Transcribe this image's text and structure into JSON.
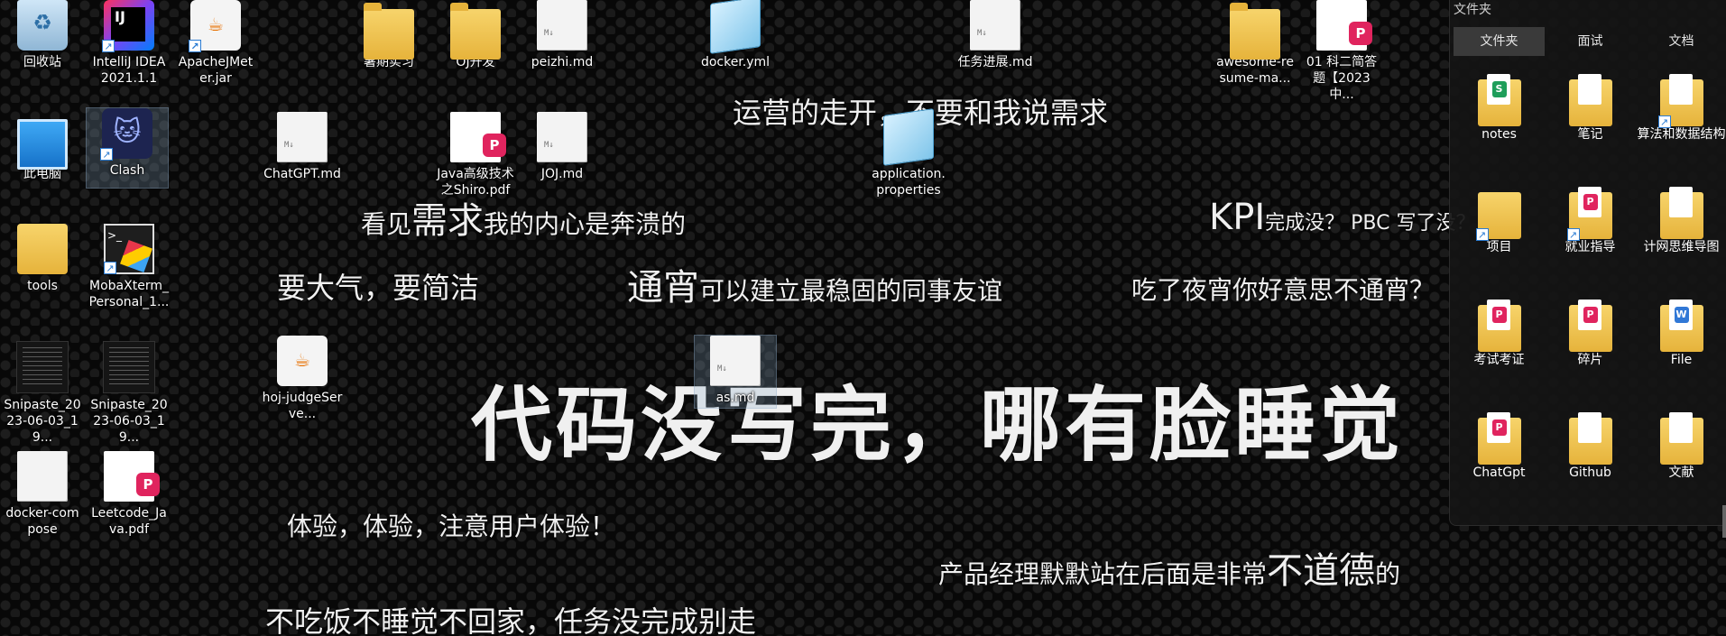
{
  "wallpaper": {
    "headline": "代码没写完，哪有脸睡觉",
    "lines": [
      {
        "id": "l1",
        "text": "运营的走开，不要和我说需求"
      },
      {
        "id": "l2_pre",
        "text": "看见"
      },
      {
        "id": "l2_big",
        "text": "需求"
      },
      {
        "id": "l2_post",
        "text": "我的内心是奔溃的"
      },
      {
        "id": "l3",
        "text": "要大气，要简洁"
      },
      {
        "id": "l4_big",
        "text": "通宵"
      },
      {
        "id": "l4_post",
        "text": "可以建立最稳固的同事友谊"
      },
      {
        "id": "l5_big",
        "text": "KPI"
      },
      {
        "id": "l5_post",
        "text": "完成没？ PBC 写了没？"
      },
      {
        "id": "l6",
        "text": "吃了夜宵你好意思不通宵？"
      },
      {
        "id": "l7",
        "text": "体验，体验，注意用户体验！"
      },
      {
        "id": "l8_pre",
        "text": "产品经理默默站在后面是非常"
      },
      {
        "id": "l8_big",
        "text": "不道德"
      },
      {
        "id": "l8_post",
        "text": "的"
      },
      {
        "id": "l9",
        "text": "不吃饭不睡觉不回家，任务没完成别走"
      }
    ]
  },
  "desktop_icons": [
    {
      "label": "回收站",
      "icon": "recycle-bin-icon"
    },
    {
      "label": "IntelliJ IDEA 2021.1.1",
      "icon": "intellij-icon"
    },
    {
      "label": "ApacheJMeter.jar",
      "icon": "java-icon"
    },
    {
      "label": "暑期实习",
      "icon": "folder-icon"
    },
    {
      "label": "OJ开发",
      "icon": "folder-icon"
    },
    {
      "label": "peizhi.md",
      "icon": "markdown-file-icon"
    },
    {
      "label": "docker.yml",
      "icon": "notepad-icon"
    },
    {
      "label": "任务进展.md",
      "icon": "markdown-file-icon"
    },
    {
      "label": "awesome-resume-ma...",
      "icon": "folder-icon"
    },
    {
      "label": "01 科二简答题【2023中...",
      "icon": "pdf-icon"
    },
    {
      "label": "此电脑",
      "icon": "computer-icon"
    },
    {
      "label": "Clash",
      "icon": "clash-icon"
    },
    {
      "label": "ChatGPT.md",
      "icon": "markdown-file-icon"
    },
    {
      "label": "Java高级技术之Shiro.pdf",
      "icon": "pdf-icon"
    },
    {
      "label": "JOJ.md",
      "icon": "markdown-file-icon"
    },
    {
      "label": "application.properties",
      "icon": "notepad-icon"
    },
    {
      "label": "tools",
      "icon": "folder-icon"
    },
    {
      "label": "MobaXterm_Personal_1...",
      "icon": "mobaxterm-icon"
    },
    {
      "label": "Snipaste_2023-06-03_19...",
      "icon": "screenshot-icon"
    },
    {
      "label": "Snipaste_2023-06-03_19...",
      "icon": "screenshot-icon"
    },
    {
      "label": "hoj-judgeServe...",
      "icon": "java-icon"
    },
    {
      "label": "as.md",
      "icon": "markdown-file-icon"
    },
    {
      "label": "docker-compose",
      "icon": "file-icon"
    },
    {
      "label": "Leetcode_Java.pdf",
      "icon": "pdf-icon"
    }
  ],
  "md_tag": "M↓",
  "panel": {
    "title": "文件夹",
    "tabs": [
      "文件夹",
      "面试",
      "文档"
    ],
    "active_tab": "文件夹",
    "items": [
      {
        "label": "notes",
        "mark": "S",
        "color": "green"
      },
      {
        "label": "笔记",
        "mark": "",
        "color": ""
      },
      {
        "label": "算法和数据结构",
        "mark": "",
        "color": ""
      },
      {
        "label": "项目",
        "mark": "",
        "color": ""
      },
      {
        "label": "就业指导",
        "mark": "P",
        "color": "red"
      },
      {
        "label": "计网思维导图",
        "mark": "",
        "color": ""
      },
      {
        "label": "考试考证",
        "mark": "P",
        "color": "red"
      },
      {
        "label": "碎片",
        "mark": "P",
        "color": "red"
      },
      {
        "label": "File",
        "mark": "W",
        "color": "blue"
      },
      {
        "label": "ChatGpt",
        "mark": "P",
        "color": "red"
      },
      {
        "label": "Github",
        "mark": "",
        "color": ""
      },
      {
        "label": "文献",
        "mark": "",
        "color": ""
      }
    ]
  },
  "colors": {
    "wallpaper_text": "#f0f0f0",
    "panel_bg": "#141414",
    "tab_active": "#3a3a3a",
    "folder_yellow": "#e6b33b",
    "pdf_red": "#e0245e"
  }
}
